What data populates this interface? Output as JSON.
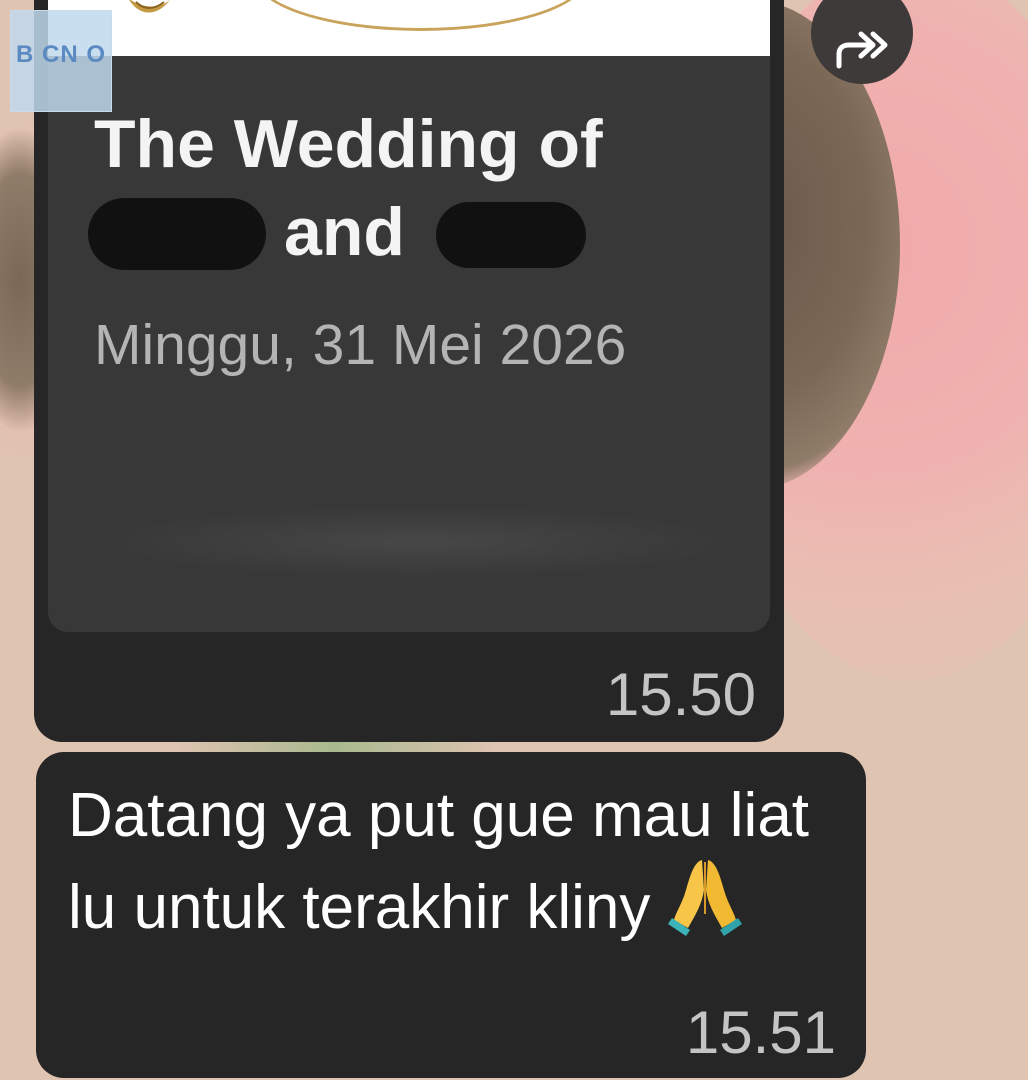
{
  "message_1": {
    "link_preview": {
      "title_line_1": "The Wedding of",
      "title_line_2_visible": "and",
      "date": "Minggu, 31 Mei 2026"
    },
    "time": "15.50"
  },
  "message_2": {
    "text": "Datang ya put gue mau liat lu untuk terakhir kliny",
    "emoji": "folded-hands",
    "time": "15.51"
  },
  "forward_icon": "forward-icon",
  "sticker": {
    "label": "B CN O"
  },
  "colors": {
    "bubble": "#262626",
    "preview_card": "#383838",
    "timestamp": "#c4c4c4",
    "date_text": "#b4b4b4",
    "wallpaper": "#e0c4b2"
  }
}
